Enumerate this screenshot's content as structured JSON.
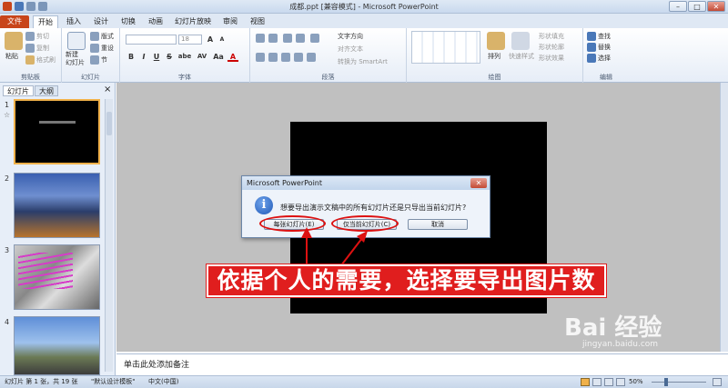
{
  "window": {
    "title": "成都.ppt [兼容模式] - Microsoft PowerPoint",
    "minimize": "–",
    "maximize": "□",
    "close": "✕"
  },
  "tabs": [
    "文件",
    "开始",
    "插入",
    "设计",
    "切换",
    "动画",
    "幻灯片放映",
    "审阅",
    "视图"
  ],
  "ribbon": {
    "clipboard": {
      "label": "剪贴板",
      "paste": "粘贴",
      "cut": "剪切",
      "copy": "复制",
      "format_painter": "格式刷"
    },
    "slides": {
      "label": "幻灯片",
      "new_slide": "新建\n幻灯片",
      "layout": "版式",
      "reset": "重设",
      "section": "节"
    },
    "font": {
      "label": "字体",
      "font_size": "18",
      "bold": "B",
      "italic": "I",
      "underline": "U",
      "strike": "S",
      "shadow": "abe",
      "spacing": "AV",
      "case": "Aa",
      "color": "A"
    },
    "paragraph": {
      "label": "段落",
      "text_direction": "文字方向",
      "align_text": "对齐文本",
      "smartart": "转换为 SmartArt"
    },
    "drawing": {
      "label": "绘图",
      "arrange": "排列",
      "quick_styles": "快速样式",
      "shape_fill": "形状填充",
      "shape_outline": "形状轮廓",
      "shape_effects": "形状效果"
    },
    "editing": {
      "label": "编辑",
      "find": "查找",
      "replace": "替换",
      "select": "选择"
    }
  },
  "pane": {
    "tab_slides": "幻灯片",
    "tab_outline": "大纲",
    "close": "×",
    "thumb_numbers": [
      "1",
      "2",
      "3",
      "4"
    ],
    "thumb1_star": "☆"
  },
  "notes": {
    "placeholder": "单击此处添加备注"
  },
  "status": {
    "slide_info": "幻灯片 第 1 张，共 19 张",
    "theme": "\"默认设计模板\"",
    "language": "中文(中国)",
    "zoom": "50%"
  },
  "dialog": {
    "title": "Microsoft PowerPoint",
    "close": "✕",
    "message": "想要导出演示文稿中的所有幻灯片还是只导出当前幻灯片?",
    "btn_all": "每张幻灯片(E)",
    "btn_current": "仅当前幻灯片(C)",
    "btn_cancel": "取消"
  },
  "annotation": {
    "text": "依据个人的需要，选择要导出图片数"
  },
  "watermark": {
    "brand": "Bai 经验",
    "url": "jingyan.baidu.com"
  },
  "colors": {
    "file_tab": "#c8451a",
    "annotation": "#e01e1e",
    "slide_bg": "#000000",
    "edit_bg": "#c0c0c0"
  }
}
